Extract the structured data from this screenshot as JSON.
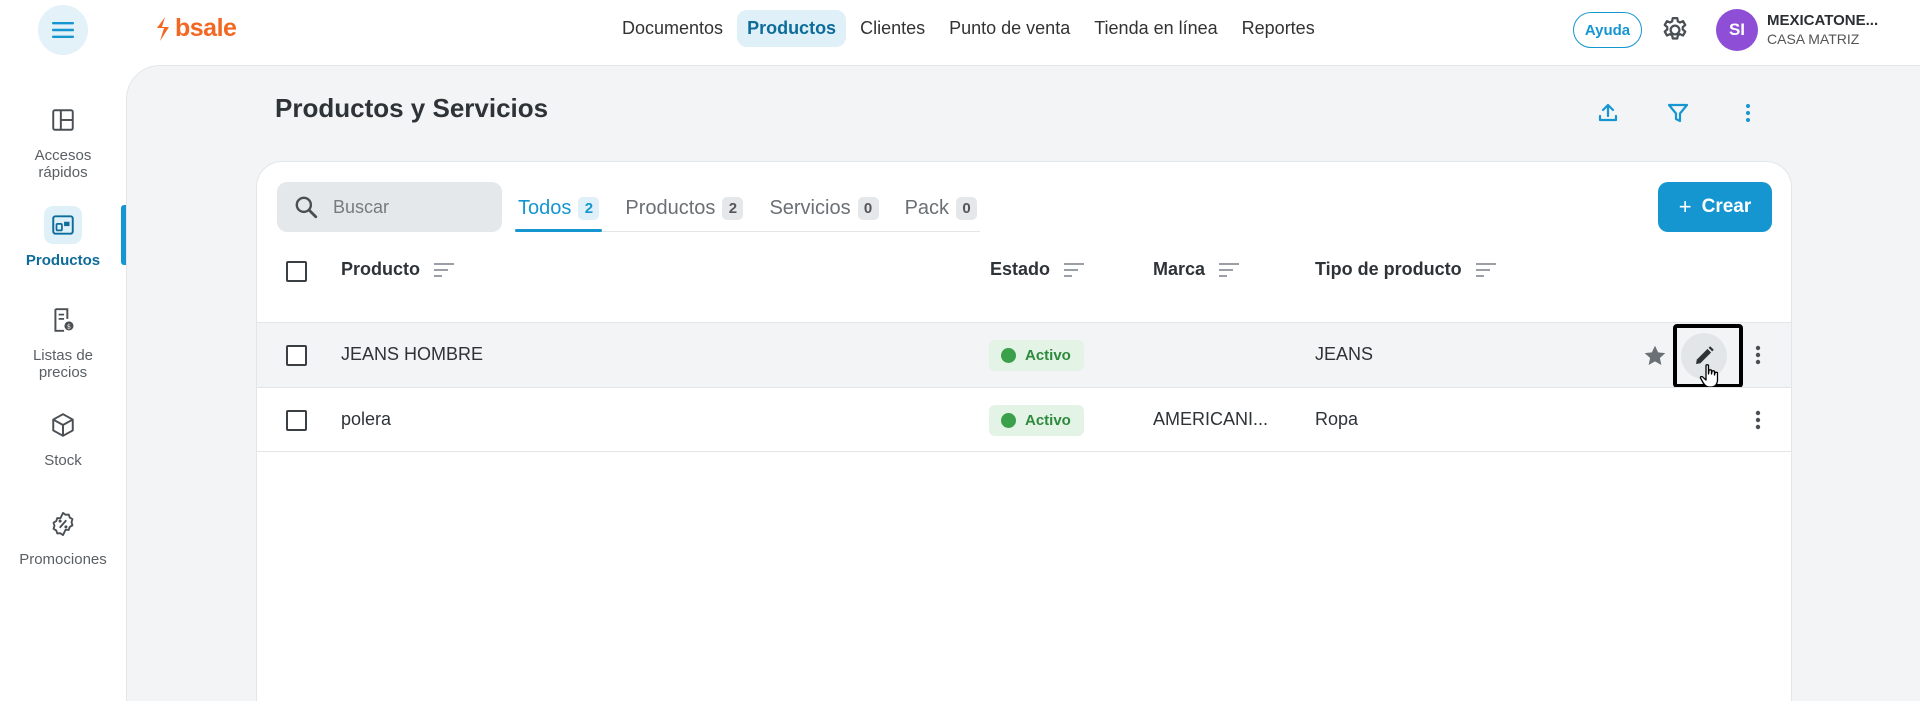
{
  "app": {
    "logo_text": "bsale",
    "brand_color": "#f26722",
    "accent_color": "#1596d1"
  },
  "topnav": {
    "items": [
      {
        "label": "Documentos",
        "active": false
      },
      {
        "label": "Productos",
        "active": true
      },
      {
        "label": "Clientes",
        "active": false
      },
      {
        "label": "Punto de venta",
        "active": false
      },
      {
        "label": "Tienda en línea",
        "active": false
      },
      {
        "label": "Reportes",
        "active": false
      }
    ],
    "help_label": "Ayuda",
    "avatar_initials": "SI",
    "company_name": "MEXICATONE...",
    "company_branch": "CASA MATRIZ"
  },
  "sidebar": {
    "items": [
      {
        "label": "Accesos rápidos",
        "icon": "dashboard-icon",
        "active": false
      },
      {
        "label": "Productos",
        "icon": "products-icon",
        "active": true
      },
      {
        "label": "Listas de precios",
        "icon": "price-list-icon",
        "active": false
      },
      {
        "label": "Stock",
        "icon": "box-icon",
        "active": false
      },
      {
        "label": "Promociones",
        "icon": "promotion-icon",
        "active": false
      }
    ]
  },
  "page": {
    "title": "Productos y Servicios"
  },
  "search": {
    "placeholder": "Buscar",
    "value": ""
  },
  "tabs": [
    {
      "label": "Todos",
      "count": "2",
      "active": true
    },
    {
      "label": "Productos",
      "count": "2",
      "active": false
    },
    {
      "label": "Servicios",
      "count": "0",
      "active": false
    },
    {
      "label": "Pack",
      "count": "0",
      "active": false
    }
  ],
  "create_button": {
    "plus": "+",
    "label": "Crear"
  },
  "table": {
    "columns": [
      "Producto",
      "Estado",
      "Marca",
      "Tipo de producto"
    ],
    "rows": [
      {
        "producto": "JEANS HOMBRE",
        "estado": "Activo",
        "marca": "",
        "tipo": "JEANS"
      },
      {
        "producto": "polera",
        "estado": "Activo",
        "marca": "AMERICANI...",
        "tipo": "Ropa"
      }
    ]
  }
}
